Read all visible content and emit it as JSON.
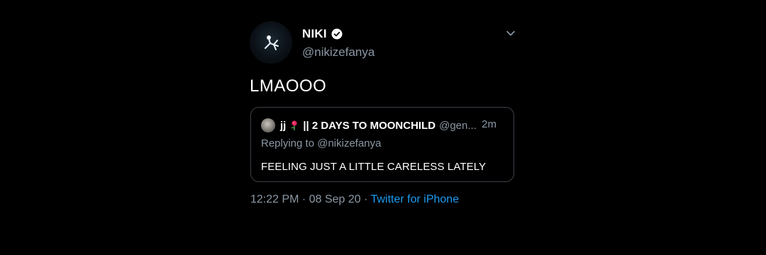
{
  "tweet": {
    "author": {
      "display_name": "NIKI",
      "handle": "@nikizefanya",
      "verified_icon": "verified-badge-icon"
    },
    "menu_icon": "chevron-down-icon",
    "text": "LMAOOO",
    "quoted": {
      "author_name": "jj",
      "emoji_icon": "rose-icon",
      "title": "|| 2 DAYS TO MOONCHILD",
      "handle": "@gen...",
      "time": "2m",
      "replying_prefix": "Replying to",
      "replying_to": "@nikizefanya",
      "text": "FEELING JUST A LITTLE CARELESS LATELY"
    },
    "timestamp": "12:22 PM · 08 Sep 20 ·",
    "source": "Twitter for iPhone"
  },
  "colors": {
    "background": "#000000",
    "primary_text": "#ffffff",
    "secondary_text": "#8b98a5",
    "link": "#1d9bf0",
    "border": "#3b4148"
  }
}
